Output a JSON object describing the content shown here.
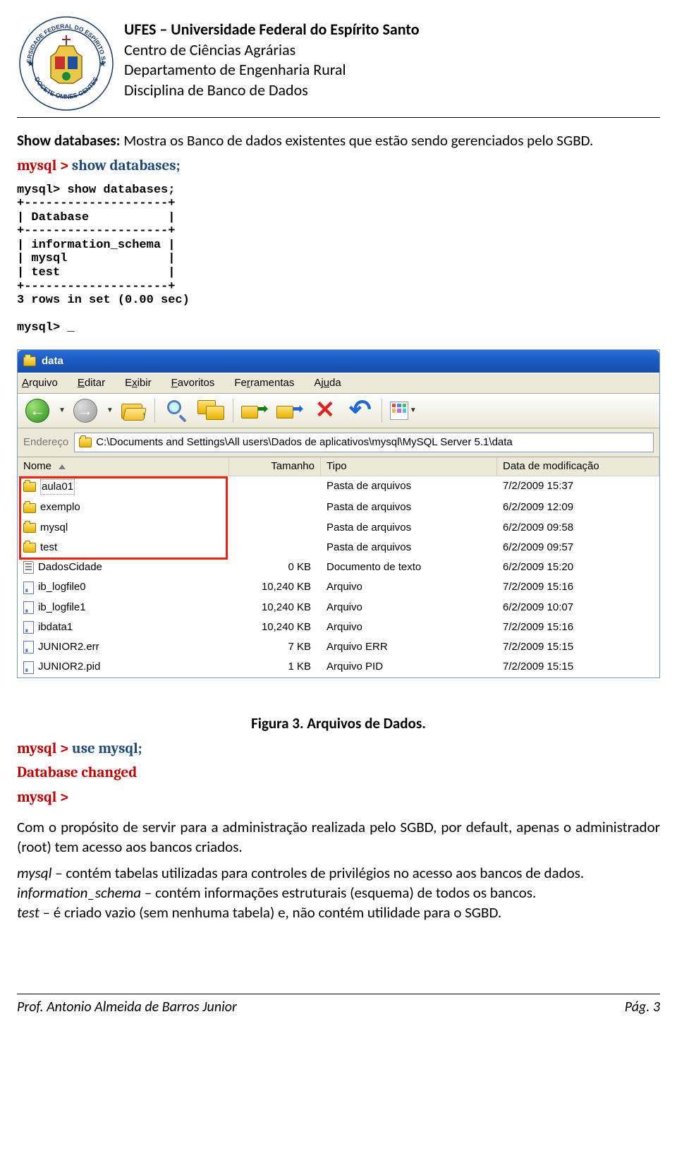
{
  "header": {
    "line1": "UFES – Universidade Federal do Espírito Santo",
    "line2": "Centro de Ciências Agrárias",
    "line3": "Departamento de Engenharia Rural",
    "line4": "Disciplina de Banco de Dados",
    "logo_outer_top": "UNIVERSIDADE FEDERAL DO ESPÍRITO SANTO",
    "logo_outer_bottom": "DOCETE OMNES GENTES"
  },
  "intro": {
    "label": "Show databases:",
    "text": " Mostra os Banco de dados existentes que estão sendo gerenciados pelo SGBD."
  },
  "cmd1_prefix": "mysql > ",
  "cmd1_body": "show databases;",
  "terminal": "mysql> show databases;\n+--------------------+\n| Database           |\n+--------------------+\n| information_schema |\n| mysql              |\n| test               |\n+--------------------+\n3 rows in set (0.00 sec)\n\nmysql> _",
  "explorer": {
    "title": "data",
    "menu": [
      "Arquivo",
      "Editar",
      "Exibir",
      "Favoritos",
      "Ferramentas",
      "Ajuda"
    ],
    "address_label": "Endereço",
    "address_value": "C:\\Documents and Settings\\All users\\Dados de aplicativos\\mysql\\MySQL Server 5.1\\data",
    "columns": [
      "Nome",
      "Tamanho",
      "Tipo",
      "Data de modificação"
    ],
    "rows": [
      {
        "icon": "folder",
        "name": "aula01",
        "size": "",
        "type": "Pasta de arquivos",
        "date": "7/2/2009 15:37",
        "sel": true
      },
      {
        "icon": "folder",
        "name": "exemplo",
        "size": "",
        "type": "Pasta de arquivos",
        "date": "6/2/2009 12:09"
      },
      {
        "icon": "folder",
        "name": "mysql",
        "size": "",
        "type": "Pasta de arquivos",
        "date": "6/2/2009 09:58"
      },
      {
        "icon": "folder",
        "name": "test",
        "size": "",
        "type": "Pasta de arquivos",
        "date": "6/2/2009 09:57"
      },
      {
        "icon": "doc",
        "name": "DadosCidade",
        "size": "0 KB",
        "type": "Documento de texto",
        "date": "6/2/2009 15:20"
      },
      {
        "icon": "sys",
        "name": "ib_logfile0",
        "size": "10,240 KB",
        "type": "Arquivo",
        "date": "7/2/2009 15:16"
      },
      {
        "icon": "sys",
        "name": "ib_logfile1",
        "size": "10,240 KB",
        "type": "Arquivo",
        "date": "6/2/2009 10:07"
      },
      {
        "icon": "sys",
        "name": "ibdata1",
        "size": "10,240 KB",
        "type": "Arquivo",
        "date": "7/2/2009 15:16"
      },
      {
        "icon": "sys",
        "name": "JUNIOR2.err",
        "size": "7 KB",
        "type": "Arquivo ERR",
        "date": "7/2/2009 15:15"
      },
      {
        "icon": "sys",
        "name": "JUNIOR2.pid",
        "size": "1 KB",
        "type": "Arquivo PID",
        "date": "7/2/2009 15:15"
      }
    ]
  },
  "fig_caption": "Figura 3. Arquivos de Dados.",
  "cmd2_prefix": "mysql > ",
  "cmd2_body": "use mysql;",
  "cmd2_line2": "Database changed",
  "cmd2_line3": "mysql >",
  "para1": "Com o propósito de servir para a administração realizada pelo SGBD, por default, apenas o administrador (root) tem acesso aos bancos criados.",
  "para2_em1": "mysql",
  "para2_t1": " – contém tabelas utilizadas para controles de privilégios no acesso aos bancos de dados.",
  "para3_em1": "information_schema",
  "para3_t1": " – contém informações estruturais (esquema) de todos os bancos.",
  "para4_em1": "test",
  "para4_t1": " – é criado vazio (sem nenhuma tabela) e, não contém utilidade para o SGBD.",
  "footer": {
    "left": "Prof. Antonio Almeida de Barros Junior",
    "right": "Pág. 3"
  }
}
